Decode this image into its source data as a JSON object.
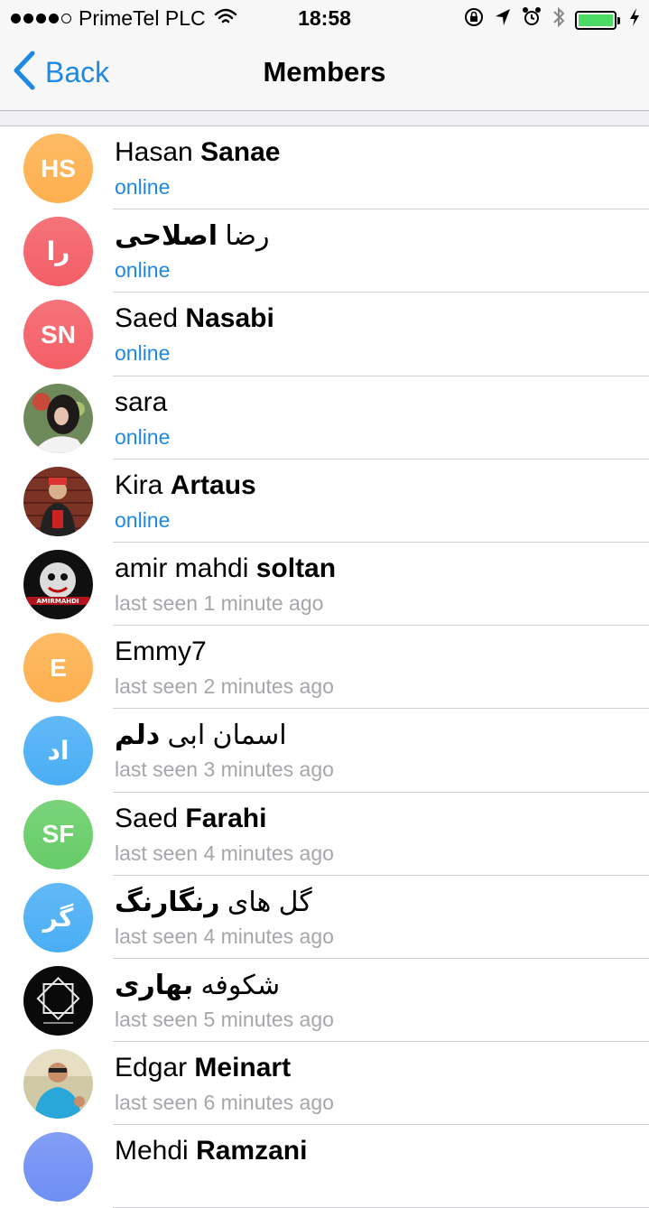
{
  "status_bar": {
    "carrier": "PrimeTel PLC",
    "time": "18:58"
  },
  "nav": {
    "back_label": "Back",
    "title": "Members"
  },
  "colors": {
    "accent": "#1e88e5",
    "online": "#1e88e5",
    "muted": "#a6a6ab"
  },
  "members": [
    {
      "first": "Hasan",
      "last": "Sanae",
      "status": "online",
      "online": true,
      "avatar_type": "initials",
      "initials": "HS",
      "avatar_color": "#fdb04e"
    },
    {
      "first": "رضا",
      "last": "اصلاحی",
      "rtl": true,
      "status": "online",
      "online": true,
      "avatar_type": "initials",
      "initials": "را",
      "avatar_color": "#f45e66"
    },
    {
      "first": "Saed",
      "last": "Nasabi",
      "status": "online",
      "online": true,
      "avatar_type": "initials",
      "initials": "SN",
      "avatar_color": "#f45e66"
    },
    {
      "first": "sara",
      "last": "",
      "status": "online",
      "online": true,
      "avatar_type": "photo",
      "icon": "photo-avatar-sara"
    },
    {
      "first": "Kira",
      "last": "Artaus",
      "status": "online",
      "online": true,
      "avatar_type": "photo",
      "icon": "photo-avatar-kira"
    },
    {
      "first": "amir mahdi",
      "last": "soltan",
      "status": "last seen 1 minute ago",
      "online": false,
      "avatar_type": "photo",
      "icon": "photo-avatar-amir"
    },
    {
      "first": "Emmy7",
      "last": "",
      "status": "last seen 2 minutes ago",
      "online": false,
      "avatar_type": "initials",
      "initials": "E",
      "avatar_color": "#fdb04e"
    },
    {
      "first": "اسمان ابی",
      "last": "دلم",
      "rtl": true,
      "status": "last seen 3 minutes ago",
      "online": false,
      "avatar_type": "initials",
      "initials": "اد",
      "avatar_color": "#4aaef5"
    },
    {
      "first": "Saed",
      "last": "Farahi",
      "status": "last seen 4 minutes ago",
      "online": false,
      "avatar_type": "initials",
      "initials": "SF",
      "avatar_color": "#66cc66"
    },
    {
      "first": "گل های",
      "last": "رنگارنگ",
      "rtl": true,
      "status": "last seen 4 minutes ago",
      "online": false,
      "avatar_type": "initials",
      "initials": "گر",
      "avatar_color": "#4aaef5"
    },
    {
      "first": "شکوفه",
      "last": "بهاری",
      "rtl": true,
      "status": "last seen 5 minutes ago",
      "online": false,
      "avatar_type": "photo",
      "icon": "photo-avatar-logo"
    },
    {
      "first": "Edgar",
      "last": "Meinart",
      "status": "last seen 6 minutes ago",
      "online": false,
      "avatar_type": "photo",
      "icon": "photo-avatar-edgar"
    },
    {
      "first": "Mehdi",
      "last": "Ramzani",
      "status": "",
      "online": false,
      "avatar_type": "initials",
      "initials": "",
      "avatar_color": "#6f8ff5"
    }
  ]
}
